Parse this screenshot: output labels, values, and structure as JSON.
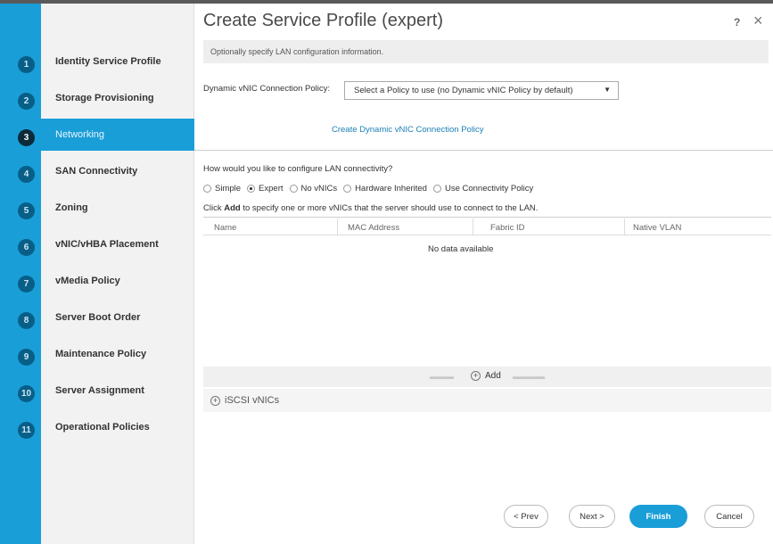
{
  "dialog": {
    "title": "Create Service Profile (expert)",
    "help_label": "?",
    "close_label": "×"
  },
  "steps": [
    {
      "number": "1",
      "label": "Identity Service Profile"
    },
    {
      "number": "2",
      "label": "Storage Provisioning"
    },
    {
      "number": "3",
      "label": "Networking"
    },
    {
      "number": "4",
      "label": "SAN Connectivity"
    },
    {
      "number": "5",
      "label": "Zoning"
    },
    {
      "number": "6",
      "label": "vNIC/vHBA Placement"
    },
    {
      "number": "7",
      "label": "vMedia Policy"
    },
    {
      "number": "8",
      "label": "Server Boot Order"
    },
    {
      "number": "9",
      "label": "Maintenance Policy"
    },
    {
      "number": "10",
      "label": "Server Assignment"
    },
    {
      "number": "11",
      "label": "Operational Policies"
    }
  ],
  "active_step": "Networking",
  "networking": {
    "hint": "Optionally specify LAN configuration information.",
    "dynamic_vnic_label": "Dynamic vNIC Connection Policy:",
    "dynamic_vnic_value": "Select a Policy to use (no Dynamic vNIC Policy by default)",
    "create_link": "Create Dynamic vNIC Connection Policy",
    "question": "How would you like to configure LAN connectivity?",
    "options": [
      "Simple",
      "Expert",
      "No vNICs",
      "Hardware Inherited",
      "Use Connectivity Policy"
    ],
    "selected_option": "Expert",
    "instruction_prefix": "Click",
    "instruction_bold": "Add",
    "instruction_suffix": "to specify one or more vNICs that the server should use to connect to the LAN.",
    "columns": [
      "Name",
      "MAC Address",
      "Fabric ID",
      "Native VLAN"
    ],
    "rows": [],
    "empty_text": "No data available",
    "add_label": "Add",
    "iscsi_label": "iSCSI vNICs"
  },
  "footer": {
    "prev": "< Prev",
    "next": "Next >",
    "finish": "Finish",
    "cancel": "Cancel"
  },
  "colors": {
    "accent": "#1a9ed8",
    "step_circle": "#075f88"
  }
}
